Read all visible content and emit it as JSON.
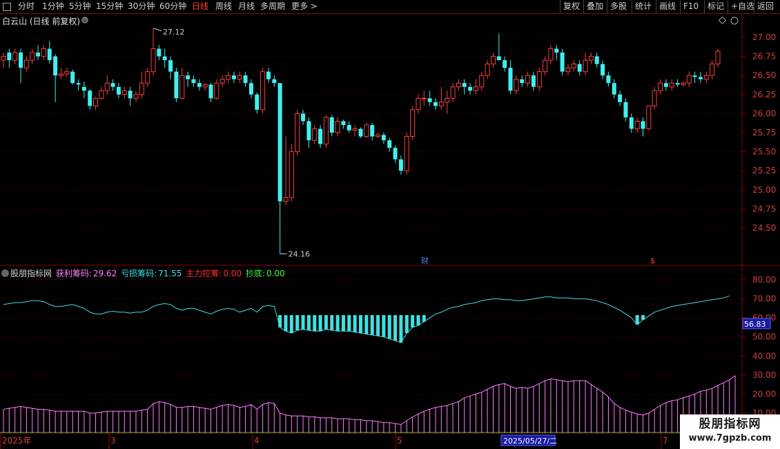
{
  "toolbar": {
    "periods": [
      "分时",
      "1分钟",
      "5分钟",
      "15分钟",
      "30分钟",
      "60分钟",
      "日线",
      "周线",
      "月线",
      "多周期",
      "更多 >"
    ],
    "active": "日线",
    "right_buttons": [
      "复权",
      "叠加",
      "多股",
      "统计",
      "画线",
      "F10",
      "+自选",
      "返回"
    ],
    "mark_label": "标记"
  },
  "stock": {
    "name": "白云山",
    "period_note": "(日线 前复权)"
  },
  "price_axis": [
    "27.00",
    "26.75",
    "26.50",
    "26.25",
    "26.00",
    "25.75",
    "25.50",
    "25.25",
    "25.00",
    "24.75",
    "24.50"
  ],
  "annotations": {
    "high": "27.12",
    "low": "24.16",
    "cai_marker": "财",
    "s_marker": "$"
  },
  "indicator": {
    "name": "股朋指标网",
    "items": [
      {
        "label": "获利筹码:",
        "value": "29.62",
        "color": "#ff80ff"
      },
      {
        "label": "亏损筹码:",
        "value": "71.55",
        "color": "#40e0e0"
      },
      {
        "label": "主力控筹:",
        "value": "0.00",
        "color": "#ff3030"
      },
      {
        "label": "抄底:",
        "value": "0.00",
        "color": "#40ff40"
      }
    ],
    "axis": [
      "80.00",
      "70.00",
      "60.00",
      "50.00",
      "40.00",
      "30.00",
      "20.00",
      "10.00"
    ],
    "current_value": "56.83"
  },
  "date_axis": {
    "labels": [
      "2025年",
      "3",
      "4",
      "5",
      "7"
    ],
    "cursor_date": "2025/05/27/二"
  },
  "watermark": {
    "title": "股朋指标网",
    "url": "www.7gpzb.com"
  },
  "colors": {
    "up": "#ff4040",
    "down": "#40f0f0",
    "profit": "#ff80ff",
    "loss": "#40e0e0",
    "grid": "#6a0000"
  },
  "chart_data": {
    "type": "candlestick",
    "ylim": [
      24.16,
      27.12
    ],
    "candles": [
      [
        26.7,
        26.75,
        26.6,
        26.8
      ],
      [
        26.8,
        26.7,
        26.6,
        26.85
      ],
      [
        26.7,
        26.8,
        26.65,
        26.85
      ],
      [
        26.8,
        26.6,
        26.4,
        26.85
      ],
      [
        26.6,
        26.7,
        26.55,
        26.75
      ],
      [
        26.7,
        26.8,
        26.65,
        26.85
      ],
      [
        26.8,
        26.75,
        26.7,
        26.9
      ],
      [
        26.75,
        26.85,
        26.7,
        26.9
      ],
      [
        26.85,
        26.7,
        26.65,
        26.95
      ],
      [
        26.75,
        26.5,
        26.15,
        26.78
      ],
      [
        26.5,
        26.52,
        26.45,
        26.6
      ],
      [
        26.52,
        26.55,
        26.48,
        26.6
      ],
      [
        26.55,
        26.4,
        26.38,
        26.58
      ],
      [
        26.4,
        26.38,
        26.3,
        26.45
      ],
      [
        26.35,
        26.3,
        26.2,
        26.42
      ],
      [
        26.3,
        26.1,
        26.05,
        26.32
      ],
      [
        26.1,
        26.2,
        26.05,
        26.22
      ],
      [
        26.2,
        26.3,
        26.18,
        26.35
      ],
      [
        26.3,
        26.4,
        26.25,
        26.5
      ],
      [
        26.4,
        26.35,
        26.3,
        26.45
      ],
      [
        26.35,
        26.25,
        26.2,
        26.4
      ],
      [
        26.25,
        26.3,
        26.2,
        26.35
      ],
      [
        26.3,
        26.2,
        26.1,
        26.35
      ],
      [
        26.2,
        26.25,
        26.15,
        26.3
      ],
      [
        26.25,
        26.4,
        26.2,
        26.55
      ],
      [
        26.4,
        26.55,
        26.35,
        26.6
      ],
      [
        26.55,
        26.85,
        26.5,
        27.12
      ],
      [
        26.85,
        26.75,
        26.7,
        26.9
      ],
      [
        26.75,
        26.7,
        26.6,
        26.85
      ],
      [
        26.7,
        26.55,
        26.45,
        26.75
      ],
      [
        26.55,
        26.2,
        26.15,
        26.6
      ],
      [
        26.2,
        26.5,
        26.18,
        26.6
      ],
      [
        26.5,
        26.45,
        26.35,
        26.55
      ],
      [
        26.45,
        26.4,
        26.35,
        26.5
      ],
      [
        26.4,
        26.35,
        26.3,
        26.45
      ],
      [
        26.35,
        26.38,
        26.3,
        26.4
      ],
      [
        26.38,
        26.2,
        26.15,
        26.4
      ],
      [
        26.2,
        26.4,
        26.18,
        26.45
      ],
      [
        26.4,
        26.45,
        26.35,
        26.5
      ],
      [
        26.45,
        26.5,
        26.4,
        26.55
      ],
      [
        26.5,
        26.45,
        26.4,
        26.55
      ],
      [
        26.45,
        26.5,
        26.4,
        26.55
      ],
      [
        26.5,
        26.4,
        26.35,
        26.55
      ],
      [
        26.4,
        26.25,
        26.2,
        26.45
      ],
      [
        26.25,
        26.05,
        26.0,
        26.28
      ],
      [
        26.05,
        26.55,
        26.0,
        26.6
      ],
      [
        26.55,
        26.45,
        26.4,
        26.6
      ],
      [
        26.45,
        26.4,
        26.35,
        26.5
      ],
      [
        26.4,
        24.85,
        24.16,
        26.0
      ],
      [
        24.85,
        24.9,
        24.8,
        25.7
      ],
      [
        24.9,
        25.5,
        24.85,
        25.6
      ],
      [
        25.5,
        26.0,
        25.45,
        26.05
      ],
      [
        26.0,
        25.9,
        25.85,
        26.05
      ],
      [
        25.9,
        25.65,
        25.55,
        25.95
      ],
      [
        25.65,
        25.8,
        25.6,
        25.85
      ],
      [
        25.8,
        25.6,
        25.55,
        25.85
      ],
      [
        25.6,
        25.95,
        25.55,
        25.98
      ],
      [
        25.95,
        25.75,
        25.7,
        25.98
      ],
      [
        25.75,
        25.9,
        25.7,
        25.95
      ],
      [
        25.9,
        25.85,
        25.8,
        25.92
      ],
      [
        25.85,
        25.78,
        25.75,
        25.9
      ],
      [
        25.78,
        25.8,
        25.7,
        25.85
      ],
      [
        25.8,
        25.7,
        25.68,
        25.82
      ],
      [
        25.7,
        25.85,
        25.68,
        25.88
      ],
      [
        25.85,
        25.7,
        25.65,
        25.88
      ],
      [
        25.7,
        25.72,
        25.68,
        25.75
      ],
      [
        25.72,
        25.65,
        25.6,
        25.75
      ],
      [
        25.65,
        25.55,
        25.5,
        25.68
      ],
      [
        25.55,
        25.4,
        25.35,
        25.58
      ],
      [
        25.4,
        25.25,
        25.2,
        25.45
      ],
      [
        25.25,
        25.7,
        25.2,
        25.75
      ],
      [
        25.7,
        26.05,
        25.65,
        26.1
      ],
      [
        26.05,
        26.2,
        26.0,
        26.25
      ],
      [
        26.2,
        26.2,
        26.1,
        26.3
      ],
      [
        26.2,
        26.15,
        26.1,
        26.3
      ],
      [
        26.15,
        26.1,
        26.05,
        26.2
      ],
      [
        26.1,
        26.15,
        26.05,
        26.35
      ],
      [
        26.15,
        26.2,
        26.0,
        26.3
      ],
      [
        26.2,
        26.35,
        26.15,
        26.4
      ],
      [
        26.35,
        26.4,
        26.3,
        26.45
      ],
      [
        26.4,
        26.35,
        26.25,
        26.45
      ],
      [
        26.35,
        26.3,
        26.25,
        26.4
      ],
      [
        26.3,
        26.35,
        26.25,
        26.45
      ],
      [
        26.35,
        26.5,
        26.3,
        26.55
      ],
      [
        26.5,
        26.65,
        26.45,
        26.7
      ],
      [
        26.65,
        26.75,
        26.6,
        26.8
      ],
      [
        26.75,
        26.7,
        27.05,
        26.7
      ],
      [
        26.7,
        26.6,
        26.55,
        26.75
      ],
      [
        26.6,
        26.3,
        26.25,
        26.7
      ],
      [
        26.3,
        26.45,
        26.25,
        26.5
      ],
      [
        26.45,
        26.4,
        26.35,
        26.5
      ],
      [
        26.4,
        26.5,
        26.35,
        26.55
      ],
      [
        26.5,
        26.35,
        26.3,
        26.55
      ],
      [
        26.35,
        26.55,
        26.3,
        26.6
      ],
      [
        26.55,
        26.7,
        26.5,
        26.75
      ],
      [
        26.7,
        26.85,
        26.65,
        26.9
      ],
      [
        26.85,
        26.8,
        26.7,
        26.9
      ],
      [
        26.8,
        26.55,
        26.5,
        26.85
      ],
      [
        26.55,
        26.6,
        26.5,
        26.65
      ],
      [
        26.6,
        26.65,
        26.55,
        26.7
      ],
      [
        26.65,
        26.55,
        26.5,
        26.7
      ],
      [
        26.55,
        26.7,
        26.5,
        26.8
      ],
      [
        26.7,
        26.75,
        26.65,
        26.8
      ],
      [
        26.75,
        26.65,
        26.6,
        26.8
      ],
      [
        26.65,
        26.5,
        26.45,
        26.7
      ],
      [
        26.5,
        26.4,
        26.35,
        26.55
      ],
      [
        26.4,
        26.25,
        26.2,
        26.45
      ],
      [
        26.25,
        26.15,
        26.1,
        26.3
      ],
      [
        26.15,
        25.95,
        25.9,
        26.2
      ],
      [
        25.95,
        25.8,
        25.75,
        26.0
      ],
      [
        25.8,
        25.9,
        25.75,
        25.95
      ],
      [
        25.9,
        25.8,
        25.7,
        25.95
      ],
      [
        25.8,
        26.1,
        25.78,
        26.1
      ],
      [
        26.1,
        26.3,
        26.05,
        26.35
      ],
      [
        26.3,
        26.4,
        26.25,
        26.45
      ],
      [
        26.4,
        26.35,
        26.3,
        26.45
      ],
      [
        26.35,
        26.4,
        26.3,
        26.45
      ],
      [
        26.4,
        26.38,
        26.35,
        26.45
      ],
      [
        26.38,
        26.4,
        26.35,
        26.42
      ],
      [
        26.4,
        26.5,
        26.35,
        26.55
      ],
      [
        26.5,
        26.48,
        26.4,
        26.55
      ],
      [
        26.48,
        26.45,
        26.4,
        26.55
      ],
      [
        26.45,
        26.5,
        26.4,
        26.55
      ],
      [
        26.5,
        26.65,
        26.45,
        26.7
      ],
      [
        26.65,
        26.82,
        26.6,
        26.85
      ]
    ],
    "indicator_series": [
      {
        "name": "亏损筹码",
        "values": [
          67,
          67.5,
          68,
          68,
          68.5,
          69,
          69,
          68.5,
          67,
          66,
          66,
          66.5,
          67,
          66,
          65,
          63,
          62,
          62,
          63,
          63.5,
          63,
          63,
          62.5,
          63,
          63,
          64,
          66,
          67,
          67.5,
          67,
          65,
          64,
          65,
          65,
          64,
          63,
          62,
          63.5,
          64.5,
          65,
          64.5,
          63,
          64,
          65,
          63,
          66,
          66.5,
          66,
          55,
          53,
          52,
          53.5,
          54,
          53.5,
          53,
          53,
          54,
          53.5,
          53,
          53,
          53,
          52.5,
          52,
          51.5,
          51,
          50.5,
          50,
          49,
          48,
          47,
          52,
          55,
          56,
          58,
          60,
          62,
          63,
          64.5,
          65.5,
          66,
          67,
          67.5,
          68,
          69,
          69.5,
          70,
          70,
          69.5,
          69.5,
          69,
          69,
          69.5,
          70,
          70.5,
          71,
          71,
          70.5,
          70.5,
          70.5,
          70,
          70,
          70,
          69.5,
          69,
          68,
          67,
          65.5,
          64,
          62,
          60,
          56.5,
          59,
          61,
          63,
          64,
          65,
          66,
          66.5,
          67,
          67.5,
          68,
          68.5,
          69,
          69.5,
          70,
          70.5,
          71.55
        ]
      },
      {
        "name": "获利筹码",
        "values": [
          12,
          12.5,
          13,
          13.5,
          13,
          12.5,
          12,
          12,
          11.5,
          11,
          11,
          11,
          11,
          11,
          11,
          10,
          10,
          10.5,
          11,
          11,
          11,
          11,
          11,
          11,
          11.5,
          12,
          15,
          16,
          15.5,
          14.5,
          13,
          13,
          13.5,
          13.5,
          13,
          12.5,
          12,
          13,
          14,
          14.5,
          14,
          13,
          13.5,
          14.5,
          12,
          14.5,
          15.5,
          15,
          10,
          9,
          8.5,
          8.5,
          8.5,
          8,
          8,
          7.5,
          7.5,
          7.5,
          7,
          7,
          7,
          6.5,
          6.5,
          6,
          6,
          5.5,
          5,
          5,
          4.5,
          4,
          6,
          8,
          9.5,
          11,
          12,
          13,
          13.5,
          14,
          15,
          16,
          18,
          19,
          20,
          21,
          22.5,
          24,
          25,
          25.5,
          24,
          23,
          23.5,
          23,
          24,
          25.5,
          27,
          28,
          27.5,
          27,
          26.5,
          27,
          27,
          27,
          25,
          23,
          21,
          18.5,
          15,
          13,
          11.5,
          10.5,
          9.5,
          9,
          10,
          12,
          14,
          15.5,
          16.5,
          17,
          18,
          19,
          20,
          21.5,
          22,
          23,
          24.5,
          26,
          27.5,
          29.62
        ]
      }
    ]
  }
}
